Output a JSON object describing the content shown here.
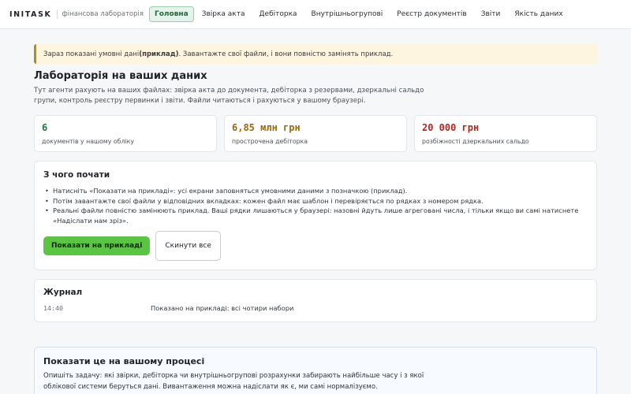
{
  "header": {
    "brand": "INITASK",
    "brand_sub": "фінансова лабораторія",
    "nav": [
      {
        "label": "Головна",
        "active": true
      },
      {
        "label": "Звірка акта"
      },
      {
        "label": "Дебіторка"
      },
      {
        "label": "Внутрішньогрупові"
      },
      {
        "label": "Реєстр документів"
      },
      {
        "label": "Звіти"
      },
      {
        "label": "Якість даних"
      }
    ]
  },
  "notice": {
    "before": "Зараз показані умовні дані ",
    "bold": "(приклад)",
    "after": ". Завантажте свої файли, і вони повністю замінять приклад."
  },
  "page": {
    "title": "Лабораторія на ваших даних",
    "description": "Тут агенти рахують на ваших файлах: звірка акта до документа, дебіторка з резервами, дзеркальні сальдо групи, контроль реєстру первинки і звіти. Файли читаються і рахуються у вашому браузері."
  },
  "stats": [
    {
      "value": "6",
      "label": "документів у нашому обліку",
      "color": "#1e7a3c"
    },
    {
      "value": "6,85 млн грн",
      "label": "прострочена дебіторка",
      "color": "#9a6b05"
    },
    {
      "value": "20 000 грн",
      "label": "розбіжності дзеркальних сальдо",
      "color": "#b3261e"
    }
  ],
  "start": {
    "title": "З чого почати",
    "steps": [
      "Натисніть «Показати на прикладі»: усі екрани заповняться умовними даними з позначкою (приклад).",
      "Потім завантажте свої файли у відповідних вкладках: кожен файл має шаблон і перевіряється по рядках з номером рядка.",
      "Реальні файли повністю замінюють приклад. Ваші рядки лишаються у браузері: назовні йдуть лише агреговані числа, і тільки якщо ви самі натиснете «Надіслати нам зріз»."
    ],
    "primary_button": "Показати на прикладі",
    "secondary_button": "Скинути все"
  },
  "journal": {
    "title": "Журнал",
    "entries": [
      {
        "time": "14:40",
        "text": "Показано на прикладі: всі чотири набори"
      }
    ]
  },
  "process": {
    "title": "Показати це на вашому процесі",
    "description": "Опишіть задачу: які звірки, дебіторка чи внутрішньогрупові розрахунки забирають найбільше часу і з якої облікової системи беруться дані. Вивантаження можна надіслати як є, ми самі нормалізуємо."
  }
}
